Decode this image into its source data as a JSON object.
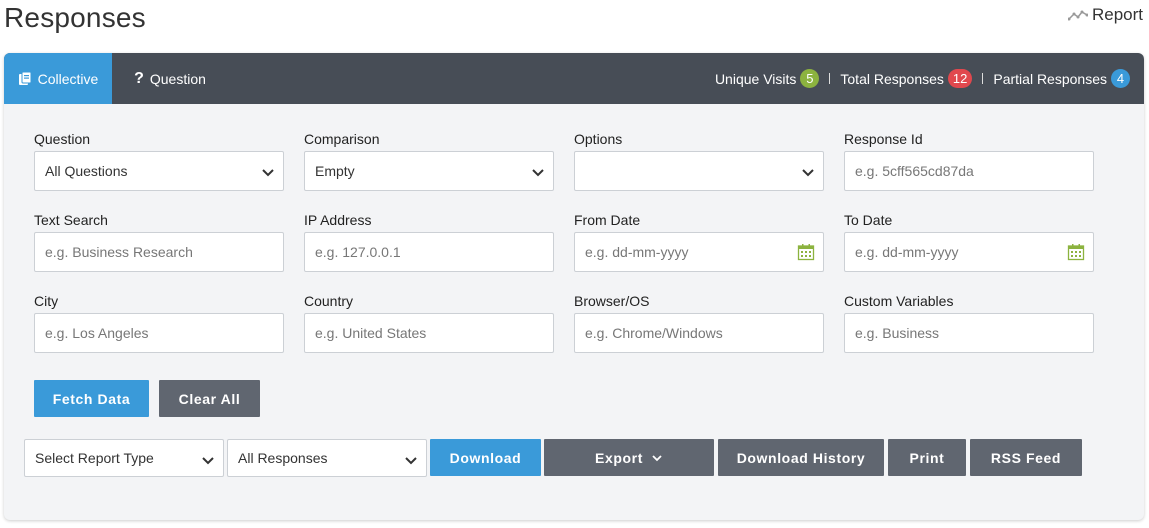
{
  "page": {
    "title": "Responses"
  },
  "report_link": {
    "label": "Report",
    "icon": "chart-line-icon"
  },
  "tabs": [
    {
      "label": "Collective",
      "icon": "clipboard-icon",
      "active": true
    },
    {
      "label": "Question",
      "icon": "question-icon",
      "active": false
    }
  ],
  "stats": {
    "unique_visits": {
      "label": "Unique Visits",
      "count": "5",
      "color": "#8cb33f"
    },
    "total_responses": {
      "label": "Total Responses",
      "count": "12",
      "color": "#e1484e"
    },
    "partial_responses": {
      "label": "Partial Responses",
      "count": "4",
      "color": "#3a9ad9"
    }
  },
  "filters": {
    "question": {
      "label": "Question",
      "value": "All Questions"
    },
    "comparison": {
      "label": "Comparison",
      "value": "Empty"
    },
    "options": {
      "label": "Options",
      "value": ""
    },
    "response_id": {
      "label": "Response Id",
      "placeholder": "e.g. 5cff565cd87da"
    },
    "text_search": {
      "label": "Text Search",
      "placeholder": "e.g. Business Research"
    },
    "ip_address": {
      "label": "IP Address",
      "placeholder": "e.g. 127.0.0.1"
    },
    "from_date": {
      "label": "From Date",
      "placeholder": "e.g. dd-mm-yyyy"
    },
    "to_date": {
      "label": "To Date",
      "placeholder": "e.g. dd-mm-yyyy"
    },
    "city": {
      "label": "City",
      "placeholder": "e.g. Los Angeles"
    },
    "country": {
      "label": "Country",
      "placeholder": "e.g. United States"
    },
    "browser_os": {
      "label": "Browser/OS",
      "placeholder": "e.g. Chrome/Windows"
    },
    "custom_variables": {
      "label": "Custom Variables",
      "placeholder": "e.g. Business"
    }
  },
  "actions": {
    "fetch_data": "Fetch Data",
    "clear_all": "Clear All"
  },
  "report_bar": {
    "report_type": "Select Report Type",
    "responses_filter": "All Responses",
    "download": "Download",
    "export": "Export",
    "download_history": "Download History",
    "print": "Print",
    "rss_feed": "RSS Feed"
  },
  "colors": {
    "accent": "#3a9ad9",
    "tabbar": "#474d56",
    "button_gray": "#606670",
    "calendar_icon": "#8cb33f"
  }
}
